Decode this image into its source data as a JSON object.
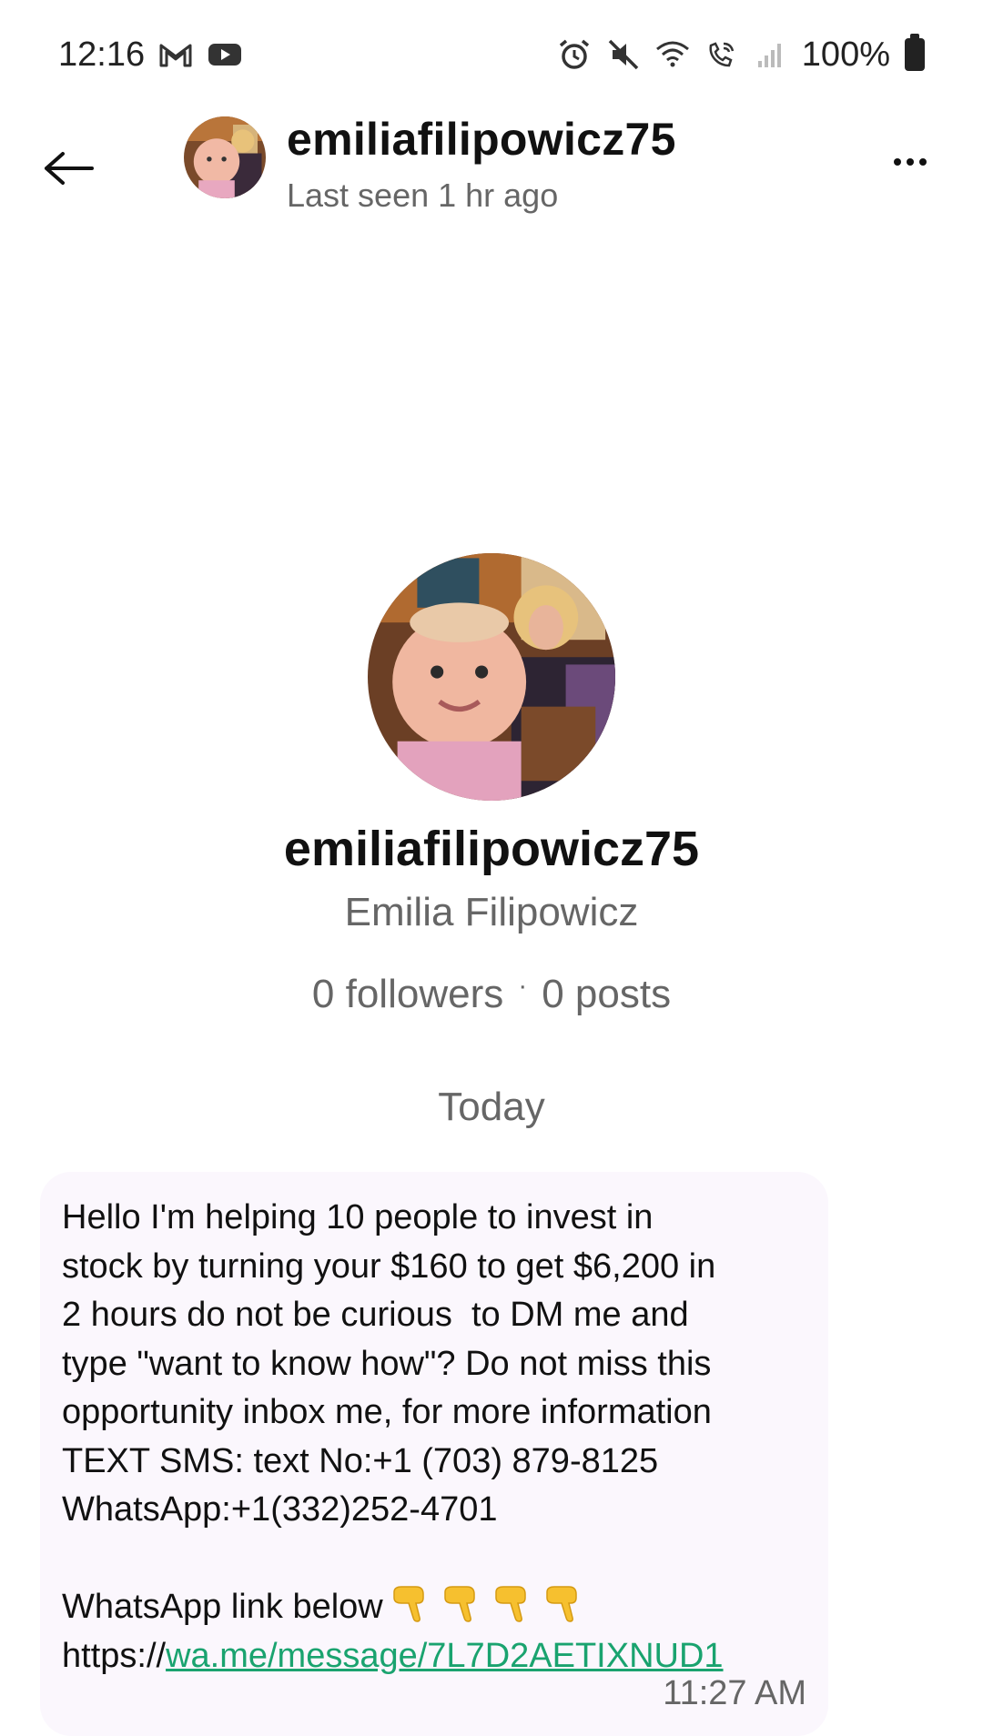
{
  "status_bar": {
    "time": "12:16",
    "battery": "100%",
    "icons": [
      "gmail-icon",
      "youtube-icon",
      "alarm-icon",
      "mute-icon",
      "wifi-icon",
      "wifi-calling-icon",
      "signal-icon",
      "battery-icon"
    ]
  },
  "header": {
    "back_icon": "back-arrow-icon",
    "username": "emiliafilipowicz75",
    "status": "Last seen 1 hr ago",
    "more_icon": "more-options-icon"
  },
  "profile": {
    "username": "emiliafilipowicz75",
    "display_name": "Emilia Filipowicz",
    "followers": "0 followers",
    "separator": "·",
    "posts": "0 posts"
  },
  "date_label": "Today",
  "message": {
    "text": "Hello I'm helping 10 people to invest in\nstock by turning your $160 to get $6,200 in\n2 hours do not be curious  to DM me and\ntype \"want to know how\"? Do not miss this\nopportunity inbox me, for more information\nTEXT SMS: text No:+1 (703) 879-8125\nWhatsApp:+1(332)252-4701\n\n",
    "link_intro": "WhatsApp link below",
    "emoji_icon": "pointing-down-hand-icon",
    "link_prefix": "https://",
    "link_text": "wa.me/message/7L7D2AETIXNUD1",
    "time": "11:27 AM"
  },
  "colors": {
    "link": "#1aa36f",
    "bubble_bg": "#fbf7fd",
    "secondary_text": "#666666"
  }
}
